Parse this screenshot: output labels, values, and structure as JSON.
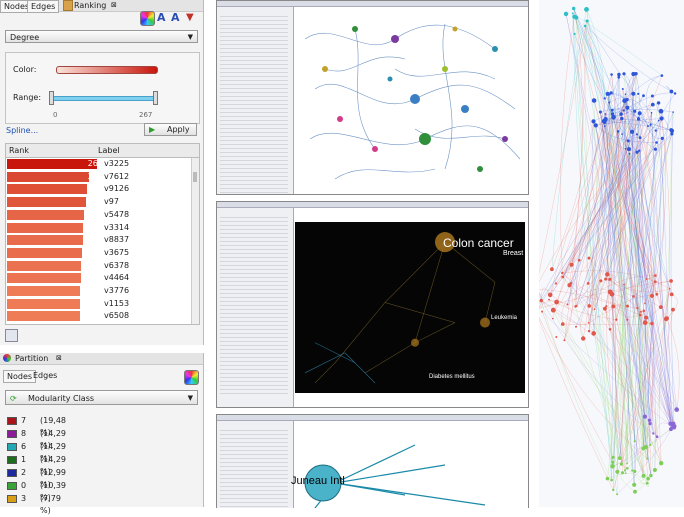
{
  "ranking": {
    "title": "Ranking",
    "tabs": [
      "Nodes",
      "Edges"
    ],
    "attribute": "Degree",
    "color_label": "Color:",
    "range_label": "Range:",
    "range_min": "0",
    "range_max": "267",
    "spline_link": "Spline...",
    "apply_label": "Apply",
    "columns": [
      "Rank",
      "Label"
    ],
    "rows": [
      {
        "rank": "267",
        "label": "v3225"
      },
      {
        "rank": "204",
        "label": "v7612"
      },
      {
        "rank": "195",
        "label": "v9126"
      },
      {
        "rank": "186",
        "label": "v97"
      },
      {
        "rank": "167",
        "label": "v5478"
      },
      {
        "rank": "165",
        "label": "v3314"
      },
      {
        "rank": "160",
        "label": "v8837"
      },
      {
        "rank": "157",
        "label": "v3675"
      },
      {
        "rank": "151",
        "label": "v6378"
      },
      {
        "rank": "148",
        "label": "v4464"
      },
      {
        "rank": "141",
        "label": "v3776"
      },
      {
        "rank": "140",
        "label": "v1153"
      },
      {
        "rank": "139",
        "label": "v6508"
      }
    ],
    "colors": {
      "start": "#f5c4a8",
      "end": "#c8160c"
    }
  },
  "partition": {
    "title": "Partition",
    "tabs": [
      "Nodes",
      "Edges"
    ],
    "attribute": "Modularity Class",
    "items": [
      {
        "key": "7",
        "pct": "(19,48 %)",
        "color": "#a8151b"
      },
      {
        "key": "8",
        "pct": "(14,29 %)",
        "color": "#8c1c9a"
      },
      {
        "key": "6",
        "pct": "(14,29 %)",
        "color": "#23a9b4"
      },
      {
        "key": "1",
        "pct": "(14,29 %)",
        "color": "#1c6e1c"
      },
      {
        "key": "2",
        "pct": "(12,99 %)",
        "color": "#1d2a9e"
      },
      {
        "key": "0",
        "pct": "(10,39 %)",
        "color": "#3aa43a"
      },
      {
        "key": "3",
        "pct": "(7,79 %)",
        "color": "#d9a015"
      }
    ]
  },
  "screens": {
    "middle_labels": [
      "Colon cancer",
      "Breast",
      "Leukemia",
      "Diabetes mellitus"
    ],
    "bottom_labels": [
      "Juneau Intl"
    ]
  }
}
